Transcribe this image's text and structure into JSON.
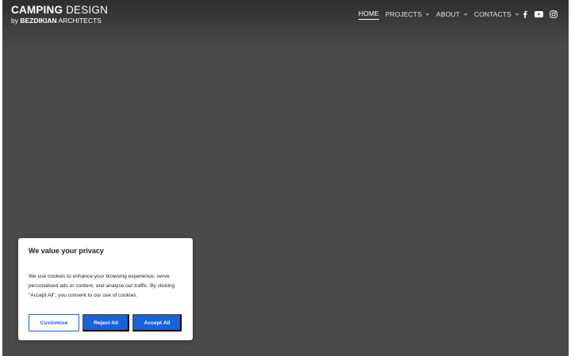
{
  "logo": {
    "line1_bold": "CAMPING",
    "line1_light": " DESIGN",
    "line2_prefix": "by ",
    "line2_bold": "BEZDIKIAN",
    "line2_suffix": " ARCHITECTS"
  },
  "nav": {
    "items": [
      {
        "label": "HOME",
        "active": true,
        "has_dropdown": false
      },
      {
        "label": "PROJECTS",
        "active": false,
        "has_dropdown": true
      },
      {
        "label": "ABOUT",
        "active": false,
        "has_dropdown": true
      },
      {
        "label": "CONTACTS",
        "active": false,
        "has_dropdown": true
      }
    ]
  },
  "social": [
    "facebook-icon",
    "youtube-icon",
    "instagram-icon"
  ],
  "cookie": {
    "title": "We value your privacy",
    "text": "We use cookies to enhance your browsing experience, serve personalised ads or content, and analyse our traffic. By clicking \"Accept All\", you consent to our use of cookies.",
    "customise": "Customise",
    "reject": "Reject All",
    "accept": "Accept All"
  },
  "colors": {
    "hero_bg": "#4a4a4a",
    "accent": "#1863dc"
  }
}
